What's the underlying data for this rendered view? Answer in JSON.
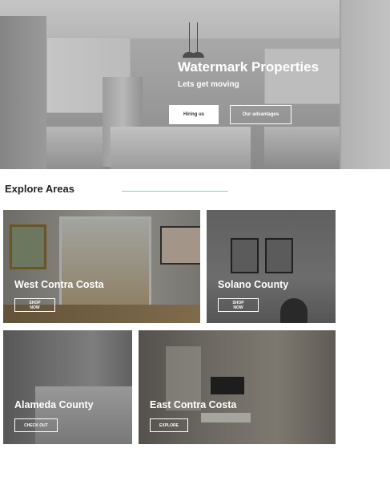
{
  "hero": {
    "title": "Watermark Properties",
    "subtitle": "Lets get moving",
    "buttons": [
      {
        "label": "Hiring us"
      },
      {
        "label": "Our advantages"
      }
    ]
  },
  "explore": {
    "title": "Explore Areas",
    "accent_color": "#7fd3d8",
    "areas": [
      {
        "name": "West Contra Costa",
        "button": "SHOP NOW"
      },
      {
        "name": "Solano County",
        "button": "SHOP NOW"
      },
      {
        "name": "Alameda County",
        "button": "CHECK OUT"
      },
      {
        "name": "East Contra Costa",
        "button": "EXPLORE"
      }
    ]
  }
}
